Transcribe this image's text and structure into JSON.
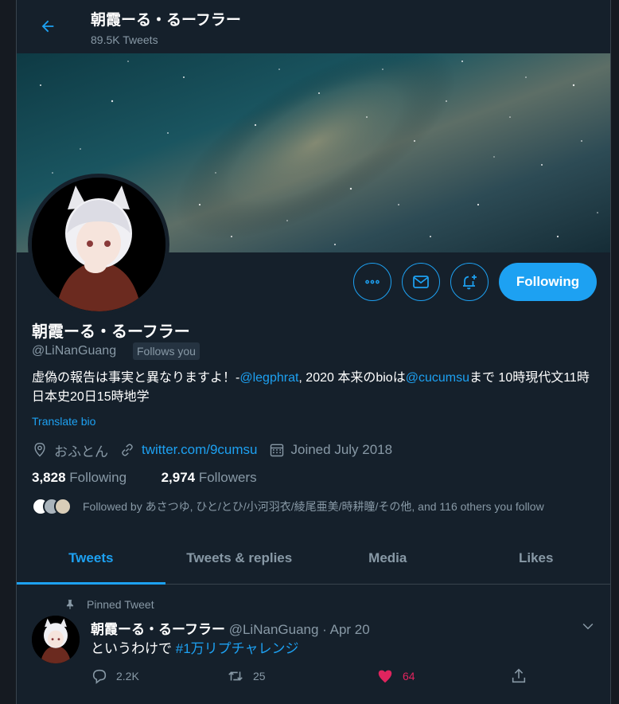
{
  "header": {
    "title": "朝霞ーる・るーフラー",
    "tweet_count": "89.5K Tweets"
  },
  "profile": {
    "name": "朝霞ーる・るーフラー",
    "handle": "@LiNanGuang",
    "follows_you": "Follows you",
    "bio": {
      "part1": "虚偽の報告は事実と異なりますよ！-",
      "mention1": "@legphrat",
      "part2": ", 2020 本来のbioは",
      "mention2": "@cucumsu",
      "part3": "まで 10時現代文11時日本史20日15時地学"
    },
    "translate": "Translate bio",
    "location": "おふとん",
    "website": "twitter.com/9cumsu",
    "joined": "Joined July 2018",
    "following_count": "3,828",
    "following_label": "Following",
    "followers_count": "2,974",
    "followers_label": "Followers",
    "followed_by": "Followed by あさつゆ, ひと/とひ/小河羽衣/綾尾亜美/時耕瞳/その他, and 116 others you follow"
  },
  "buttons": {
    "following": "Following"
  },
  "tabs": [
    {
      "label": "Tweets"
    },
    {
      "label": "Tweets & replies"
    },
    {
      "label": "Media"
    },
    {
      "label": "Likes"
    }
  ],
  "tweet": {
    "pinned_label": "Pinned Tweet",
    "name": "朝霞ーる・るーフラー",
    "handle": "@LiNanGuang",
    "date": "· Apr 20",
    "text": "というわけで ",
    "hashtag": "#1万リプチャレンジ",
    "replies": "2.2K",
    "retweets": "25",
    "likes": "64"
  },
  "colors": {
    "accent": "#1da1f2",
    "background": "#15202b",
    "like": "#e0245e",
    "muted": "#8899a6"
  }
}
